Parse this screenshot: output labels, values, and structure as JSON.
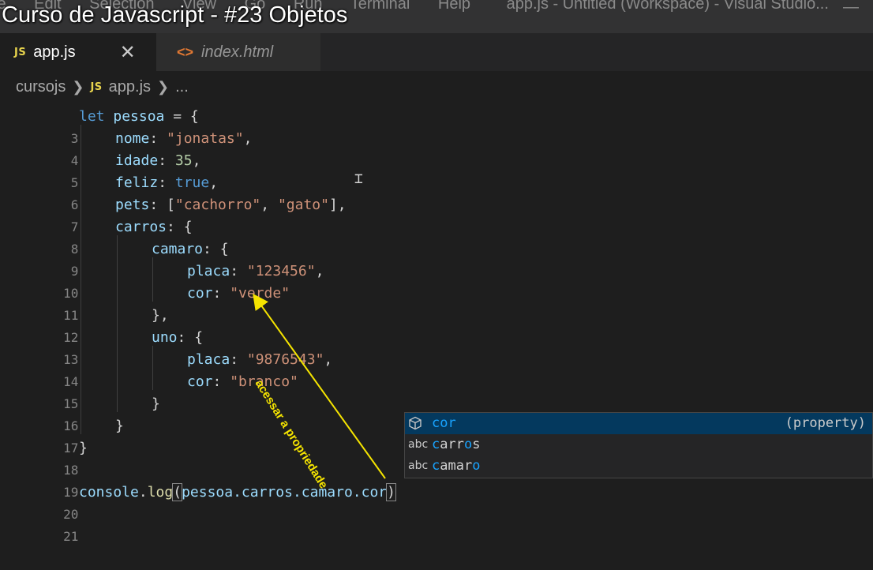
{
  "menubar": {
    "items": [
      "le",
      "Edit",
      "Selection",
      "View",
      "Go",
      "Run",
      "Terminal",
      "Help"
    ],
    "window_title": "app.js - Untitled (Workspace) - Visual Studio...",
    "minimize": "—"
  },
  "overlay_title": "Curso de Javascript - #23 Objetos",
  "tabs": [
    {
      "badge": "JS",
      "label": "app.js",
      "close": "✕",
      "active": true
    },
    {
      "badge": "<>",
      "label": "index.html",
      "active": false
    }
  ],
  "breadcrumbs": {
    "folder": "cursojs",
    "badge": "JS",
    "file": "app.js",
    "more": "..."
  },
  "editor": {
    "lines": [
      {
        "n": "3"
      },
      {
        "n": "4"
      },
      {
        "n": "5"
      },
      {
        "n": "6"
      },
      {
        "n": "7"
      },
      {
        "n": "8"
      },
      {
        "n": "9"
      },
      {
        "n": "10"
      },
      {
        "n": "11"
      },
      {
        "n": "12"
      },
      {
        "n": "13"
      },
      {
        "n": "14"
      },
      {
        "n": "15"
      },
      {
        "n": "16"
      },
      {
        "n": "17"
      },
      {
        "n": "18"
      },
      {
        "n": "19"
      },
      {
        "n": "20"
      },
      {
        "n": "21"
      }
    ],
    "code": {
      "l3": {
        "kw": "let",
        "name": "pessoa",
        "rest": " = {"
      },
      "l4": {
        "key": "nome",
        "sep": ": ",
        "val": "\"jonatas\"",
        "end": ","
      },
      "l5": {
        "key": "idade",
        "sep": ": ",
        "val": "35",
        "end": ","
      },
      "l6": {
        "key": "feliz",
        "sep": ": ",
        "val": "true",
        "end": ","
      },
      "l7": {
        "key": "pets",
        "open": ": [",
        "v1": "\"cachorro\"",
        "comma": ", ",
        "v2": "\"gato\"",
        "end": "],"
      },
      "l8": {
        "key": "carros",
        "rest": ": {"
      },
      "l9": {
        "key": "camaro",
        "rest": ": {"
      },
      "l10": {
        "key": "placa",
        "sep": ": ",
        "val": "\"123456\"",
        "end": ","
      },
      "l11": {
        "key": "cor",
        "sep": ": ",
        "val": "\"verde\""
      },
      "l12": {
        "text": "},"
      },
      "l13": {
        "key": "uno",
        "rest": ": {"
      },
      "l14": {
        "key": "placa",
        "sep": ": ",
        "val": "\"9876543\"",
        "end": ","
      },
      "l15": {
        "key": "cor",
        "sep": ": ",
        "val": "\"branco\""
      },
      "l16": {
        "text": "}"
      },
      "l17": {
        "text": "}"
      },
      "l18": {
        "text": "}"
      },
      "l20": {
        "obj": "console",
        "dot": ".",
        "fn": "log",
        "open": "(",
        "path": "pessoa.carros.camaro.cor",
        "close": ")"
      }
    }
  },
  "suggestions": [
    {
      "icon": "cube-icon",
      "glyph": "⬡",
      "label_hl": "cor",
      "label_rest": "",
      "detail": "(property)",
      "selected": true
    },
    {
      "icon": "abc-icon",
      "glyph": "abc",
      "label_pre": "",
      "label_hl1": "c",
      "label_mid": "arr",
      "label_hl2": "o",
      "label_rest": "s",
      "selected": false
    },
    {
      "icon": "abc-icon",
      "glyph": "abc",
      "label_hl1": "c",
      "label_mid": "amar",
      "label_hl2": "o",
      "label_rest": "",
      "selected": false
    }
  ],
  "annotation": {
    "text": "acessar a propriedade",
    "color": "#f5e400"
  }
}
